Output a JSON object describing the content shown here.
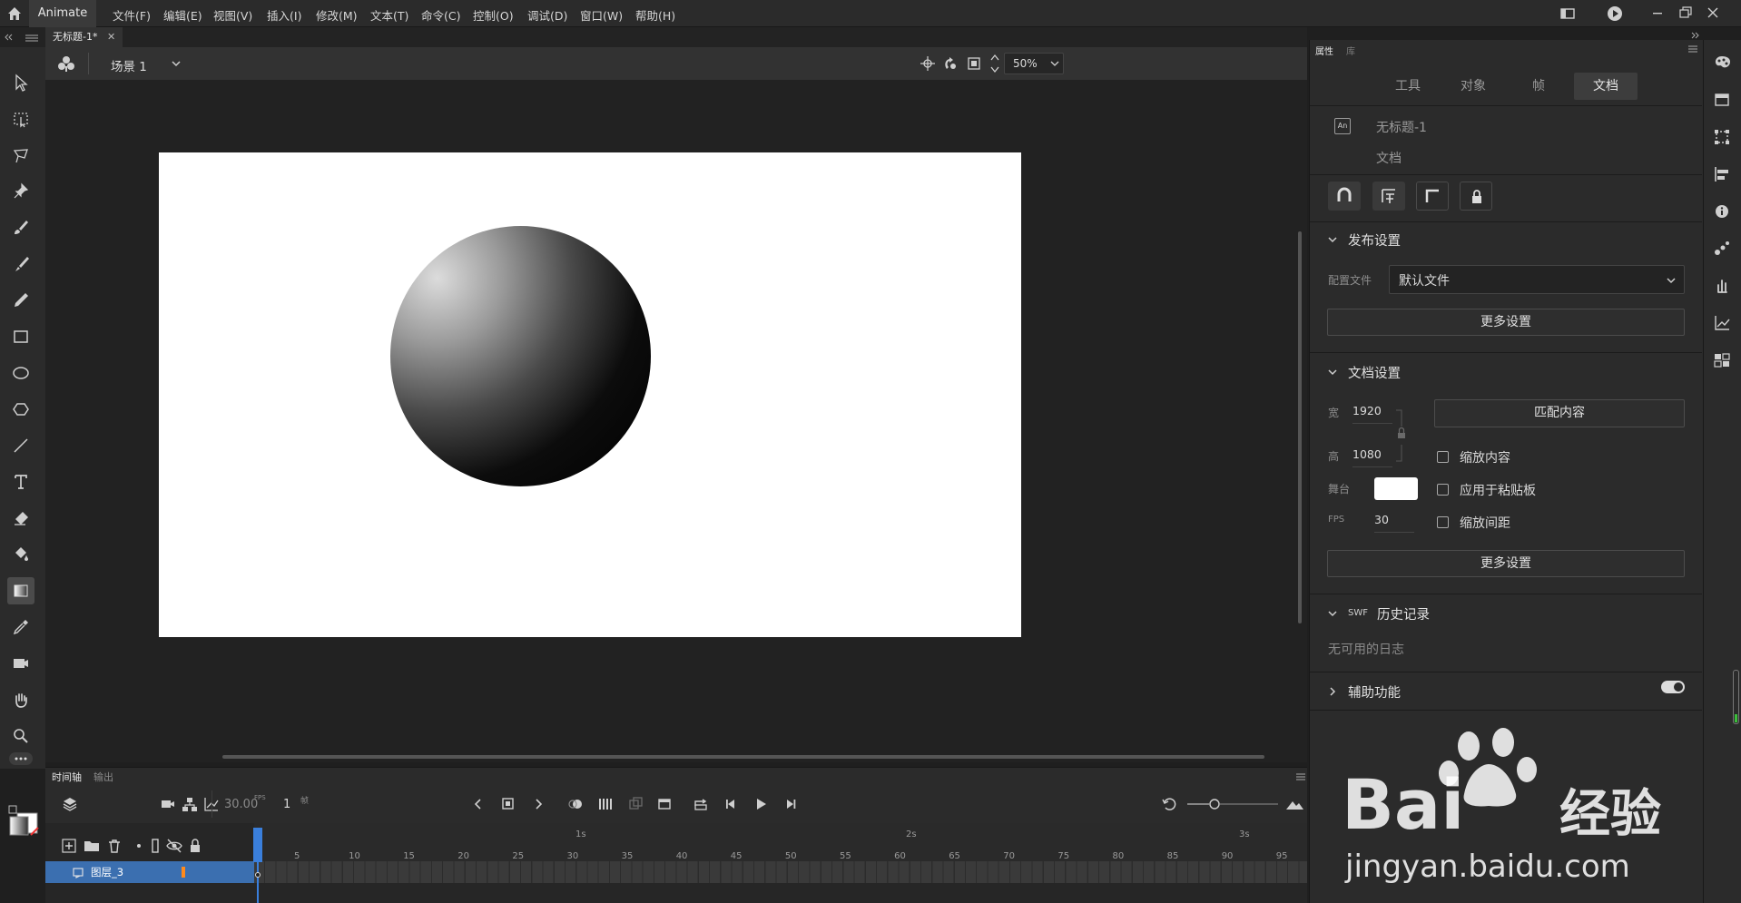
{
  "app": {
    "name": "Animate"
  },
  "menu": [
    "文件(F)",
    "编辑(E)",
    "视图(V)",
    "插入(I)",
    "修改(M)",
    "文本(T)",
    "命令(C)",
    "控制(O)",
    "调试(D)",
    "窗口(W)",
    "帮助(H)"
  ],
  "document": {
    "tab_title": "无标题-1*",
    "scene": "场景 1",
    "zoom": "50%"
  },
  "timeline": {
    "tabs": [
      "时间轴",
      "输出"
    ],
    "fps": "30.00",
    "fps_unit": "FPS",
    "current_frame": "1",
    "frame_unit": "帧",
    "layer_name": "图层_3",
    "second_marks": [
      "1s",
      "2s",
      "3s"
    ],
    "frame_ticks": [
      "5",
      "10",
      "15",
      "20",
      "25",
      "30",
      "35",
      "40",
      "45",
      "50",
      "55",
      "60",
      "65",
      "70",
      "75",
      "80",
      "85",
      "90",
      "95"
    ]
  },
  "properties": {
    "panel_tabs": [
      "属性",
      "库"
    ],
    "tabs": [
      "工具",
      "对象",
      "帧",
      "文档"
    ],
    "active_tab": "文档",
    "doc_badge": "An",
    "doc_name": "无标题-1",
    "doc_type": "文档",
    "publish": {
      "title": "发布设置",
      "profile_label": "配置文件",
      "profile_value": "默认文件",
      "more_label": "更多设置"
    },
    "doc_settings": {
      "title": "文档设置",
      "width_label": "宽",
      "width": "1920",
      "height_label": "高",
      "height": "1080",
      "stage_label": "舞台",
      "stage_color": "#ffffff",
      "fps_label": "FPS",
      "fps": "30",
      "match_label": "匹配内容",
      "scale_content": "缩放内容",
      "apply_paste": "应用于粘贴板",
      "scale_spacing": "缩放间距",
      "more_label": "更多设置"
    },
    "swf": {
      "prefix": "SWF",
      "title": "历史记录",
      "empty": "无可用的日志"
    },
    "accessibility": {
      "title": "辅助功能"
    }
  },
  "watermark": {
    "brand": "Bai",
    "brand_cn": "经验",
    "url": "jingyan.baidu.com"
  }
}
